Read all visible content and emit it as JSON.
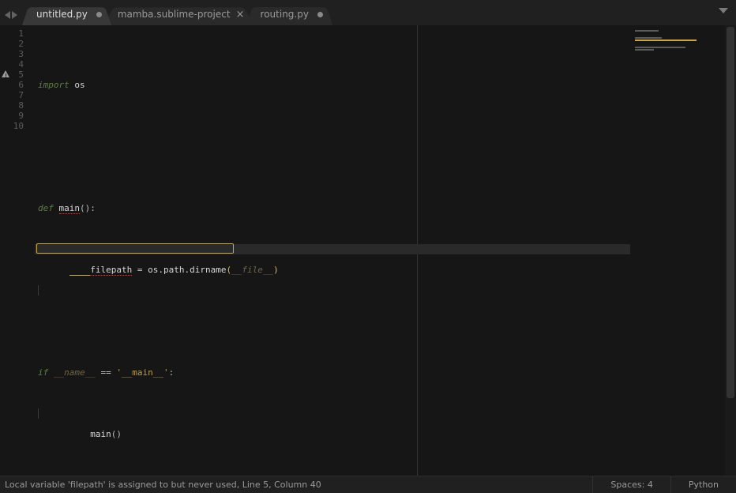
{
  "tabs": [
    {
      "label": "untitled.py",
      "dirty": true,
      "active": true
    },
    {
      "label": "mamba.sublime-project",
      "dirty": false,
      "active": false
    },
    {
      "label": "routing.py",
      "dirty": true,
      "active": false
    }
  ],
  "gutter": {
    "line_count": 10,
    "lines": [
      "1",
      "2",
      "3",
      "4",
      "5",
      "6",
      "7",
      "8",
      "9",
      "10"
    ]
  },
  "code": {
    "l1_import": "import",
    "l1_mod": "os",
    "l4_def": "def",
    "l4_name": "main",
    "l4_parens": "()",
    "l4_colon": ":",
    "l5_indent": "    ",
    "l5_var": "filepath",
    "l5_eq": " = ",
    "l5_call": "os.path.dirname",
    "l5_open": "(",
    "l5_arg": "__file__",
    "l5_close": ")",
    "l8_if": "if",
    "l8_name": "__name__",
    "l8_eqop": " == ",
    "l8_str": "'__main__'",
    "l8_colon": ":",
    "l9_indent": "    ",
    "l9_call": "main",
    "l9_parens": "()"
  },
  "status": {
    "message": "Local variable 'filepath' is assigned to but never used, Line 5, Column 40",
    "spaces": "Spaces: 4",
    "syntax": "Python"
  }
}
